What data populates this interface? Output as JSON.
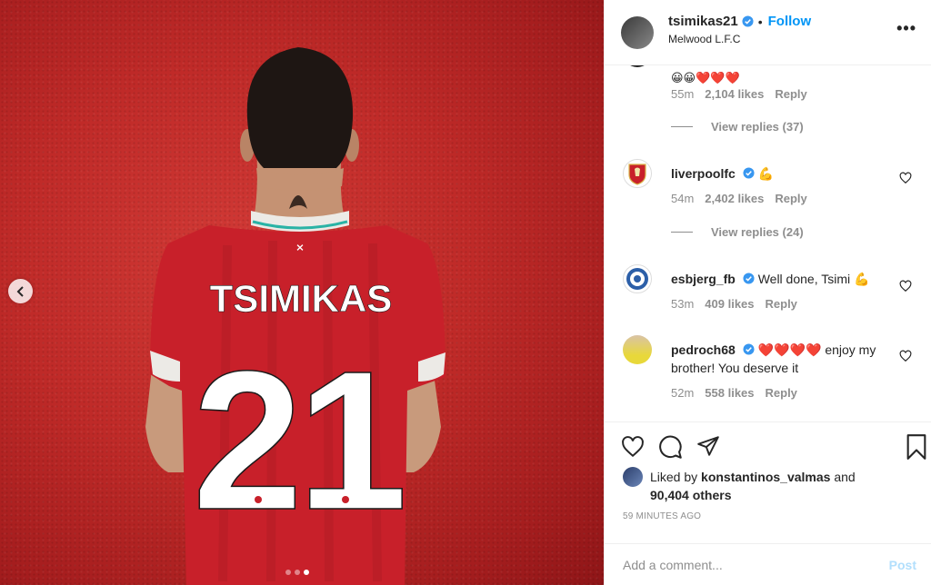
{
  "photo": {
    "jersey_name": "TSIMIKAS",
    "jersey_number": "21",
    "carousel_dots": 3,
    "active_dot": 3
  },
  "header": {
    "username": "tsimikas21",
    "separator": "•",
    "follow_label": "Follow",
    "location": "Melwood L.F.C",
    "more_label": "•••"
  },
  "comments": {
    "top_partial": {
      "emojis": "😀😀❤️❤️❤️",
      "time": "55m",
      "likes": "2,104 likes",
      "reply": "Reply",
      "view_replies": "View replies (37)"
    },
    "items": [
      {
        "username": "liverpoolfc",
        "text": "💪",
        "time": "54m",
        "likes": "2,402 likes",
        "reply": "Reply",
        "view_replies": "View replies (24)"
      },
      {
        "username": "esbjerg_fb",
        "text": "Well done, Tsimi 💪",
        "time": "53m",
        "likes": "409 likes",
        "reply": "Reply"
      },
      {
        "username": "pedroch68",
        "text": "❤️❤️❤️❤️ enjoy my brother! You deserve it",
        "time": "52m",
        "likes": "558 likes",
        "reply": "Reply"
      }
    ]
  },
  "actions": {
    "liked_by_prefix": "Liked by",
    "liked_by_user": "konstantinos_valmas",
    "liked_by_and": "and",
    "others": "90,404 others",
    "timestamp": "59 MINUTES AGO"
  },
  "add_comment": {
    "placeholder": "Add a comment...",
    "post_label": "Post"
  },
  "colors": {
    "link_blue": "#0095f6",
    "post_disabled": "#b2dffc",
    "jersey_red": "#c8202a",
    "background_red": "#bf2a28",
    "muted_text": "#8e8e8e"
  }
}
